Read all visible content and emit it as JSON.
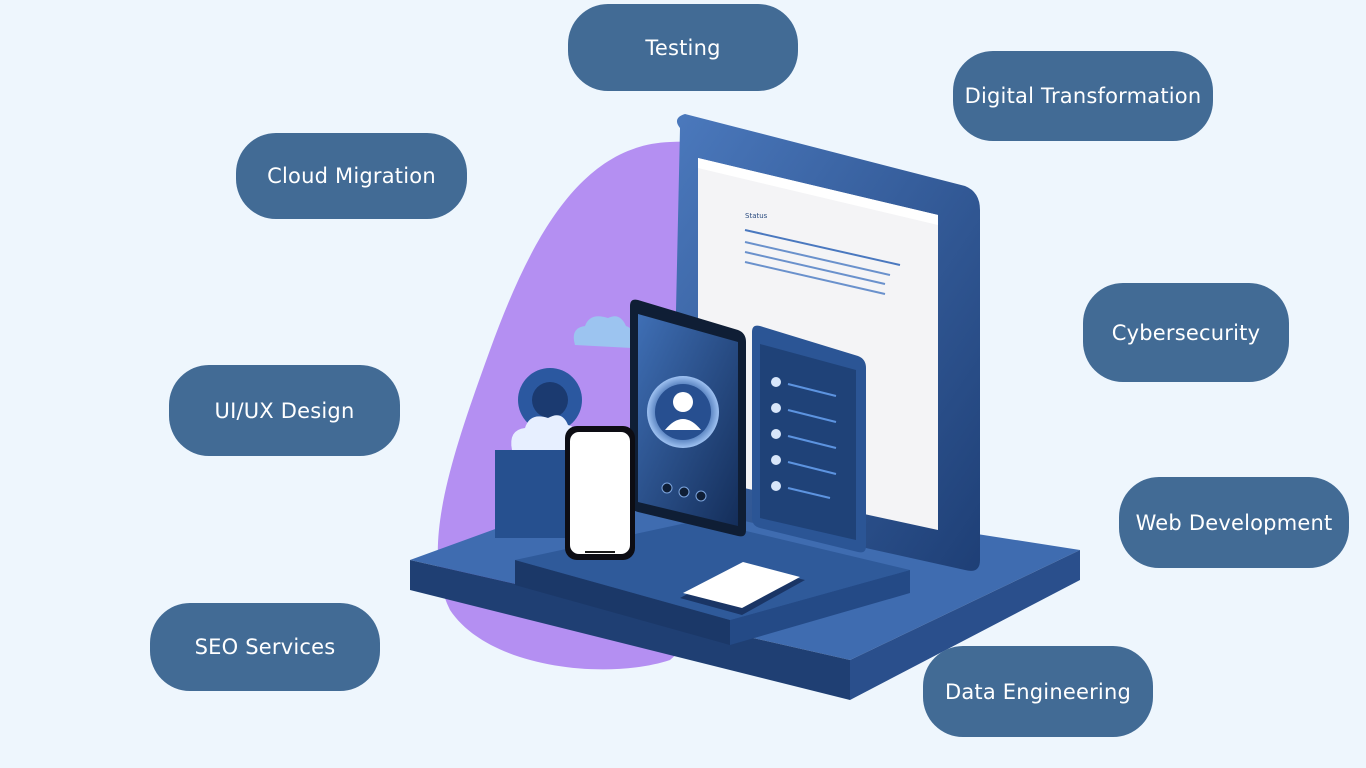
{
  "services": [
    {
      "id": "testing",
      "label": "Testing"
    },
    {
      "id": "digital-transformation",
      "label": "Digital Transformation"
    },
    {
      "id": "cloud-migration",
      "label": "Cloud Migration"
    },
    {
      "id": "cybersecurity",
      "label": "Cybersecurity"
    },
    {
      "id": "ui-ux-design",
      "label": "UI/UX Design"
    },
    {
      "id": "web-development",
      "label": "Web Development"
    },
    {
      "id": "seo-services",
      "label": "SEO Services"
    },
    {
      "id": "data-engineering",
      "label": "Data Engineering"
    }
  ],
  "colors": {
    "background": "#eef6fd",
    "pill": "#426b95",
    "pill_text": "#ffffff",
    "blob": "#b48ff2",
    "device_dark": "#23467e",
    "device_mid": "#2f5a9a",
    "device_light": "#4d7bc1",
    "screen": "#f4f4f6"
  },
  "illustration": {
    "icon": "devices-isometric-illustration",
    "screen_heading": "Status"
  }
}
